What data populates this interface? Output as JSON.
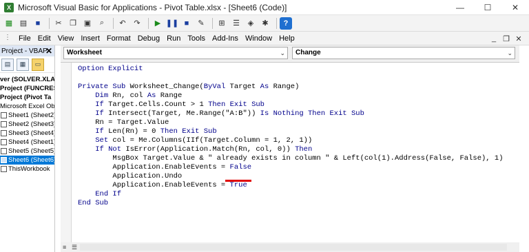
{
  "window": {
    "title": "Microsoft Visual Basic for Applications - Pivot Table.xlsx - [Sheet6 (Code)]",
    "controls": {
      "minimize": "—",
      "maximize": "☐",
      "close": "✕"
    }
  },
  "toolbar": {
    "buttons": [
      "excel-icon",
      "insert-module-icon",
      "save-icon",
      "cut-icon",
      "copy-icon",
      "paste-icon",
      "find-icon",
      "undo-icon",
      "redo-icon",
      "run-icon",
      "break-icon",
      "reset-icon",
      "design-mode-icon",
      "project-explorer-icon",
      "properties-icon",
      "object-browser-icon",
      "toolbox-icon",
      "help-icon"
    ]
  },
  "menubar": {
    "items": [
      "File",
      "Edit",
      "View",
      "Insert",
      "Format",
      "Debug",
      "Run",
      "Tools",
      "Add-Ins",
      "Window",
      "Help"
    ],
    "mdi": {
      "minimize": "_",
      "restore": "❐",
      "close": "✕"
    }
  },
  "project": {
    "title": "Project - VBAP",
    "tree": [
      {
        "label": "ver (SOLVER.XLAN",
        "bold": true,
        "icon": false
      },
      {
        "label": "Project (FUNCRES",
        "bold": true,
        "icon": false
      },
      {
        "label": "Project (Pivot Ta",
        "bold": true,
        "icon": false
      },
      {
        "label": "Microsoft Excel Obje",
        "bold": false,
        "icon": false
      },
      {
        "label": "Sheet1 (Sheet2)",
        "bold": false,
        "icon": true
      },
      {
        "label": "Sheet2 (Sheet3)",
        "bold": false,
        "icon": true
      },
      {
        "label": "Sheet3 (Sheet4)",
        "bold": false,
        "icon": true
      },
      {
        "label": "Sheet4 (Sheet1)",
        "bold": false,
        "icon": true
      },
      {
        "label": "Sheet5 (Sheet5)",
        "bold": false,
        "icon": true
      },
      {
        "label": "Sheet6 (Sheet6)",
        "bold": false,
        "icon": true,
        "selected": true
      },
      {
        "label": "ThisWorkbook",
        "bold": false,
        "icon": true
      }
    ]
  },
  "editor": {
    "object_combo": "Worksheet",
    "procedure_combo": "Change",
    "lines": [
      [
        [
          "kw",
          "Option Explicit"
        ]
      ],
      [],
      [
        [
          "kw",
          "Private Sub"
        ],
        [
          "t",
          " Worksheet_Change("
        ],
        [
          "kw",
          "ByVal"
        ],
        [
          "t",
          " Target "
        ],
        [
          "kw",
          "As"
        ],
        [
          "t",
          " Range)"
        ]
      ],
      [
        [
          "t",
          "    "
        ],
        [
          "kw",
          "Dim"
        ],
        [
          "t",
          " Rn, col "
        ],
        [
          "kw",
          "As"
        ],
        [
          "t",
          " Range"
        ]
      ],
      [
        [
          "t",
          "    "
        ],
        [
          "kw",
          "If"
        ],
        [
          "t",
          " Target.Cells.Count > 1 "
        ],
        [
          "kw",
          "Then Exit Sub"
        ]
      ],
      [
        [
          "t",
          "    "
        ],
        [
          "kw",
          "If"
        ],
        [
          "t",
          " Intersect(Target, Me.Range(\"A:B\")) "
        ],
        [
          "kw",
          "Is Nothing Then Exit Sub"
        ]
      ],
      [
        [
          "t",
          "    Rn = Target.Value"
        ]
      ],
      [
        [
          "t",
          "    "
        ],
        [
          "kw",
          "If"
        ],
        [
          "t",
          " Len(Rn) = 0 "
        ],
        [
          "kw",
          "Then Exit Sub"
        ]
      ],
      [
        [
          "t",
          "    "
        ],
        [
          "kw",
          "Set"
        ],
        [
          "t",
          " col = Me.Columns(IIf(Target.Column = 1, 2, 1))"
        ]
      ],
      [
        [
          "t",
          "    "
        ],
        [
          "kw",
          "If Not"
        ],
        [
          "t",
          " IsError(Application.Match(Rn, col, 0)) "
        ],
        [
          "kw",
          "Then"
        ]
      ],
      [
        [
          "t",
          "        MsgBox Target.Value & \" already exists in column \" & Left(col(1).Address(False, False), 1)"
        ]
      ],
      [
        [
          "t",
          "        Application.EnableEvents = "
        ],
        [
          "kw",
          "False"
        ]
      ],
      [
        [
          "t",
          "        Application.Undo"
        ]
      ],
      [
        [
          "t",
          "        Application.EnableEvents = "
        ],
        [
          "kw",
          "True"
        ]
      ],
      [
        [
          "t",
          "    "
        ],
        [
          "kw",
          "End If"
        ]
      ],
      [
        [
          "kw",
          "End Sub"
        ]
      ]
    ]
  },
  "colors": {
    "keyword": "#00008b",
    "highlight_underline": "#e00000",
    "selection": "#0078d7"
  }
}
